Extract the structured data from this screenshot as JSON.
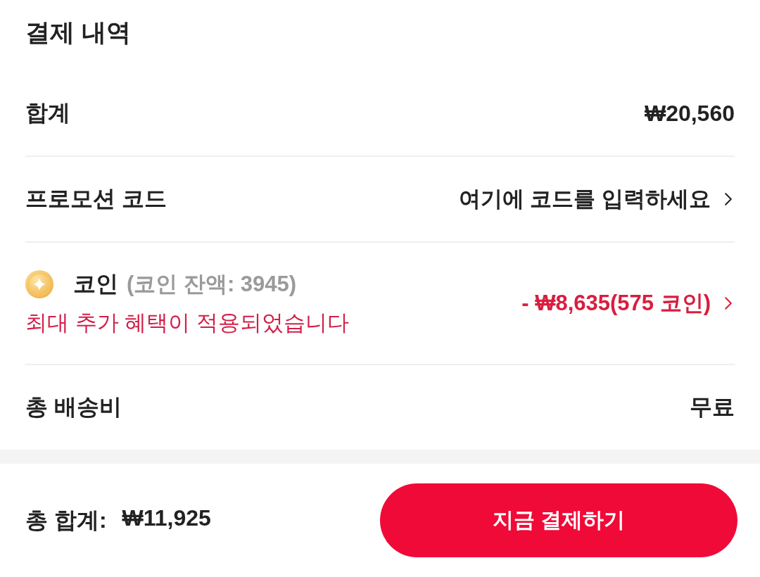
{
  "title": "결제 내역",
  "rows": [
    {
      "kind": "plain",
      "label": "합계",
      "value": "₩20,560"
    },
    {
      "kind": "link",
      "label": "프로모션 코드",
      "value": "여기에 코드를 입력하세요"
    },
    {
      "kind": "coin",
      "label": "코인",
      "balance": "(코인 잔액: 3945)",
      "note": "최대 추가 혜택이 적용되었습니다",
      "value": "- ₩8,635(575 코인)"
    },
    {
      "kind": "plain",
      "label": "총 배송비",
      "value": "무료"
    }
  ],
  "footer": {
    "total_label": "총 합계:",
    "total_value": "₩11,925",
    "button": "지금 결제하기"
  }
}
